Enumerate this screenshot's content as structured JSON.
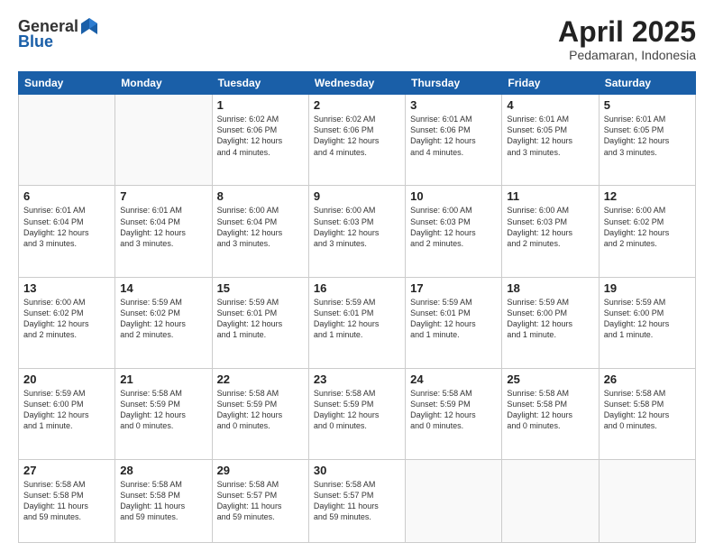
{
  "header": {
    "logo_general": "General",
    "logo_blue": "Blue",
    "month": "April 2025",
    "location": "Pedamaran, Indonesia"
  },
  "days_of_week": [
    "Sunday",
    "Monday",
    "Tuesday",
    "Wednesday",
    "Thursday",
    "Friday",
    "Saturday"
  ],
  "weeks": [
    [
      {
        "day": "",
        "info": ""
      },
      {
        "day": "",
        "info": ""
      },
      {
        "day": "1",
        "info": "Sunrise: 6:02 AM\nSunset: 6:06 PM\nDaylight: 12 hours\nand 4 minutes."
      },
      {
        "day": "2",
        "info": "Sunrise: 6:02 AM\nSunset: 6:06 PM\nDaylight: 12 hours\nand 4 minutes."
      },
      {
        "day": "3",
        "info": "Sunrise: 6:01 AM\nSunset: 6:06 PM\nDaylight: 12 hours\nand 4 minutes."
      },
      {
        "day": "4",
        "info": "Sunrise: 6:01 AM\nSunset: 6:05 PM\nDaylight: 12 hours\nand 3 minutes."
      },
      {
        "day": "5",
        "info": "Sunrise: 6:01 AM\nSunset: 6:05 PM\nDaylight: 12 hours\nand 3 minutes."
      }
    ],
    [
      {
        "day": "6",
        "info": "Sunrise: 6:01 AM\nSunset: 6:04 PM\nDaylight: 12 hours\nand 3 minutes."
      },
      {
        "day": "7",
        "info": "Sunrise: 6:01 AM\nSunset: 6:04 PM\nDaylight: 12 hours\nand 3 minutes."
      },
      {
        "day": "8",
        "info": "Sunrise: 6:00 AM\nSunset: 6:04 PM\nDaylight: 12 hours\nand 3 minutes."
      },
      {
        "day": "9",
        "info": "Sunrise: 6:00 AM\nSunset: 6:03 PM\nDaylight: 12 hours\nand 3 minutes."
      },
      {
        "day": "10",
        "info": "Sunrise: 6:00 AM\nSunset: 6:03 PM\nDaylight: 12 hours\nand 2 minutes."
      },
      {
        "day": "11",
        "info": "Sunrise: 6:00 AM\nSunset: 6:03 PM\nDaylight: 12 hours\nand 2 minutes."
      },
      {
        "day": "12",
        "info": "Sunrise: 6:00 AM\nSunset: 6:02 PM\nDaylight: 12 hours\nand 2 minutes."
      }
    ],
    [
      {
        "day": "13",
        "info": "Sunrise: 6:00 AM\nSunset: 6:02 PM\nDaylight: 12 hours\nand 2 minutes."
      },
      {
        "day": "14",
        "info": "Sunrise: 5:59 AM\nSunset: 6:02 PM\nDaylight: 12 hours\nand 2 minutes."
      },
      {
        "day": "15",
        "info": "Sunrise: 5:59 AM\nSunset: 6:01 PM\nDaylight: 12 hours\nand 1 minute."
      },
      {
        "day": "16",
        "info": "Sunrise: 5:59 AM\nSunset: 6:01 PM\nDaylight: 12 hours\nand 1 minute."
      },
      {
        "day": "17",
        "info": "Sunrise: 5:59 AM\nSunset: 6:01 PM\nDaylight: 12 hours\nand 1 minute."
      },
      {
        "day": "18",
        "info": "Sunrise: 5:59 AM\nSunset: 6:00 PM\nDaylight: 12 hours\nand 1 minute."
      },
      {
        "day": "19",
        "info": "Sunrise: 5:59 AM\nSunset: 6:00 PM\nDaylight: 12 hours\nand 1 minute."
      }
    ],
    [
      {
        "day": "20",
        "info": "Sunrise: 5:59 AM\nSunset: 6:00 PM\nDaylight: 12 hours\nand 1 minute."
      },
      {
        "day": "21",
        "info": "Sunrise: 5:58 AM\nSunset: 5:59 PM\nDaylight: 12 hours\nand 0 minutes."
      },
      {
        "day": "22",
        "info": "Sunrise: 5:58 AM\nSunset: 5:59 PM\nDaylight: 12 hours\nand 0 minutes."
      },
      {
        "day": "23",
        "info": "Sunrise: 5:58 AM\nSunset: 5:59 PM\nDaylight: 12 hours\nand 0 minutes."
      },
      {
        "day": "24",
        "info": "Sunrise: 5:58 AM\nSunset: 5:59 PM\nDaylight: 12 hours\nand 0 minutes."
      },
      {
        "day": "25",
        "info": "Sunrise: 5:58 AM\nSunset: 5:58 PM\nDaylight: 12 hours\nand 0 minutes."
      },
      {
        "day": "26",
        "info": "Sunrise: 5:58 AM\nSunset: 5:58 PM\nDaylight: 12 hours\nand 0 minutes."
      }
    ],
    [
      {
        "day": "27",
        "info": "Sunrise: 5:58 AM\nSunset: 5:58 PM\nDaylight: 11 hours\nand 59 minutes."
      },
      {
        "day": "28",
        "info": "Sunrise: 5:58 AM\nSunset: 5:58 PM\nDaylight: 11 hours\nand 59 minutes."
      },
      {
        "day": "29",
        "info": "Sunrise: 5:58 AM\nSunset: 5:57 PM\nDaylight: 11 hours\nand 59 minutes."
      },
      {
        "day": "30",
        "info": "Sunrise: 5:58 AM\nSunset: 5:57 PM\nDaylight: 11 hours\nand 59 minutes."
      },
      {
        "day": "",
        "info": ""
      },
      {
        "day": "",
        "info": ""
      },
      {
        "day": "",
        "info": ""
      }
    ]
  ]
}
